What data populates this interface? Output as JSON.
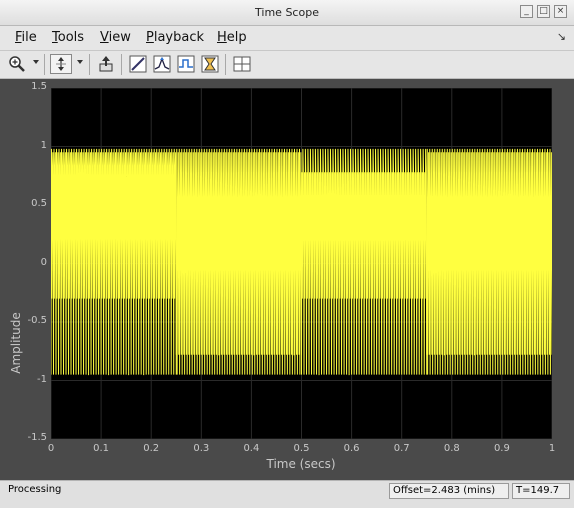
{
  "window": {
    "title": "Time Scope",
    "btn_min": "_",
    "btn_max": "□",
    "btn_close": "×"
  },
  "menu": {
    "items": [
      {
        "label": "File",
        "underline": "F",
        "rest": "ile"
      },
      {
        "label": "Tools",
        "underline": "T",
        "rest": "ools"
      },
      {
        "label": "View",
        "underline": "V",
        "rest": "iew"
      },
      {
        "label": "Playback",
        "underline": "P",
        "rest": "layback"
      },
      {
        "label": "Help",
        "underline": "H",
        "rest": "elp"
      }
    ],
    "dock_icon": "↘"
  },
  "toolbar": {
    "icons": [
      "zoom-in-icon",
      "dropdown-icon",
      "scale-axes-icon",
      "dropdown-icon",
      "restore-view-icon",
      "cursor-measurements-icon",
      "peak-finder-icon",
      "signal-statistics-icon",
      "bilevel-measurements-icon",
      "grid-icon"
    ]
  },
  "chart_data": {
    "type": "line",
    "title": "",
    "xlabel": "Time (secs)",
    "ylabel": "Amplitude",
    "xlim": [
      0,
      1
    ],
    "ylim": [
      -1.5,
      1.5
    ],
    "xticks": [
      "0",
      "0.1",
      "0.2",
      "0.3",
      "0.4",
      "0.5",
      "0.6",
      "0.7",
      "0.8",
      "0.9",
      "1"
    ],
    "yticks": [
      "1.5",
      "1",
      "0.5",
      "0",
      "-0.5",
      "-1",
      "-1.5"
    ],
    "grid": true,
    "background": "#000000",
    "line_color": "#ffff40",
    "series": [
      {
        "segments": [
          {
            "x_start": 0,
            "x_end": 0.25,
            "peak_high": 0.98,
            "peak_low": -0.95,
            "inner_high": 0.78,
            "inner_low": -0.3
          },
          {
            "x_start": 0.25,
            "x_end": 0.5,
            "peak_high": 0.98,
            "peak_low": -0.78,
            "inner_high": 0.3,
            "inner_low": -0.95
          },
          {
            "x_start": 0.5,
            "x_end": 0.75,
            "peak_high": 0.78,
            "peak_low": -0.95,
            "inner_high": 0.98,
            "inner_low": -0.3
          },
          {
            "x_start": 0.75,
            "x_end": 1.0,
            "peak_high": 0.98,
            "peak_low": -0.78,
            "inner_high": 0.3,
            "inner_low": -0.95
          }
        ]
      }
    ]
  },
  "status": {
    "text": "Processing",
    "offset": "Offset=2.483 (mins)",
    "time": "T=149.7"
  }
}
